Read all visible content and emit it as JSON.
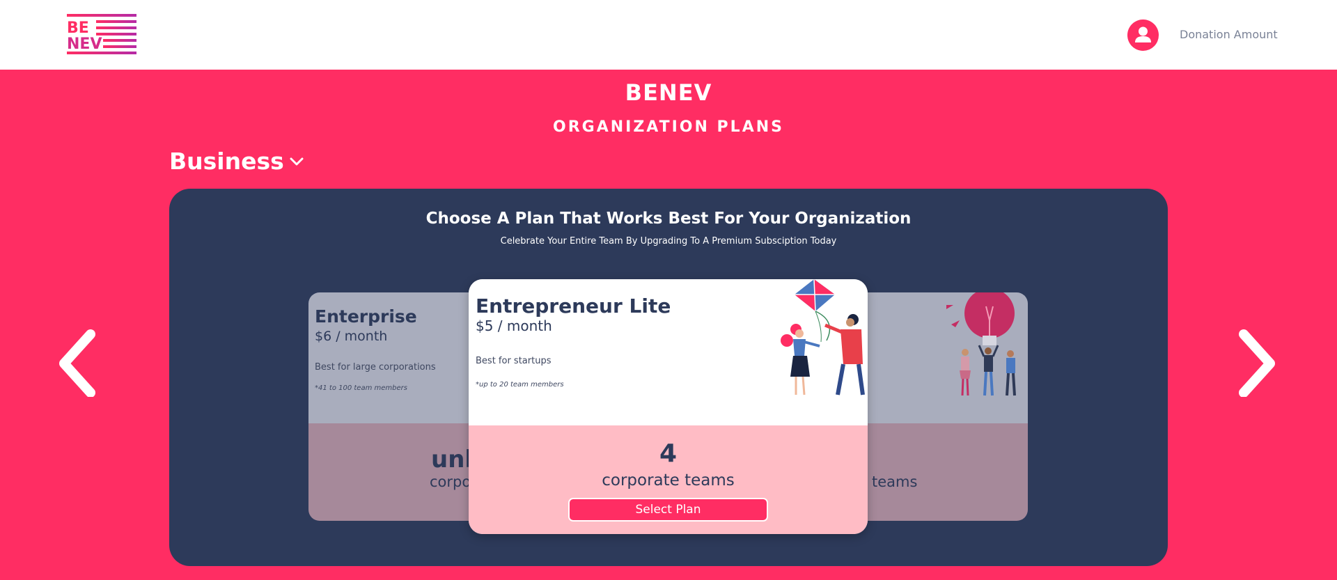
{
  "header": {
    "logo_text_top": "BE",
    "logo_text_bottom": "NEV",
    "donation_label": "Donation Amount"
  },
  "hero": {
    "brand": "BENEV",
    "subtitle": "ORGANIZATION PLANS",
    "category": "Business"
  },
  "panel": {
    "heading": "Choose A Plan That Works Best For Your Organization",
    "subheading": "Celebrate Your Entire Team By Upgrading To A Premium Subsciption Today"
  },
  "plans": {
    "left": {
      "name": "Enterprise",
      "price": "$6 / month",
      "description": "Best for large corporations",
      "note": "*41 to 100 team members",
      "count_partial": "unl",
      "unit_partial": "corpo"
    },
    "center": {
      "name": "Entrepreneur Lite",
      "price": "$5 / month",
      "description": "Best for startups",
      "note": "*up to 20 team members",
      "count": "4",
      "unit": "corporate teams",
      "button": "Select Plan"
    },
    "right": {
      "unit_partial": "teams"
    }
  },
  "colors": {
    "brand_pink": "#ff2d63",
    "navy": "#2d3a5a",
    "card_pink": "#ffbcc5"
  },
  "icons": {
    "avatar": "user-icon",
    "category_toggle": "chevron-down-icon",
    "prev": "chevron-left-icon",
    "next": "chevron-right-icon"
  }
}
